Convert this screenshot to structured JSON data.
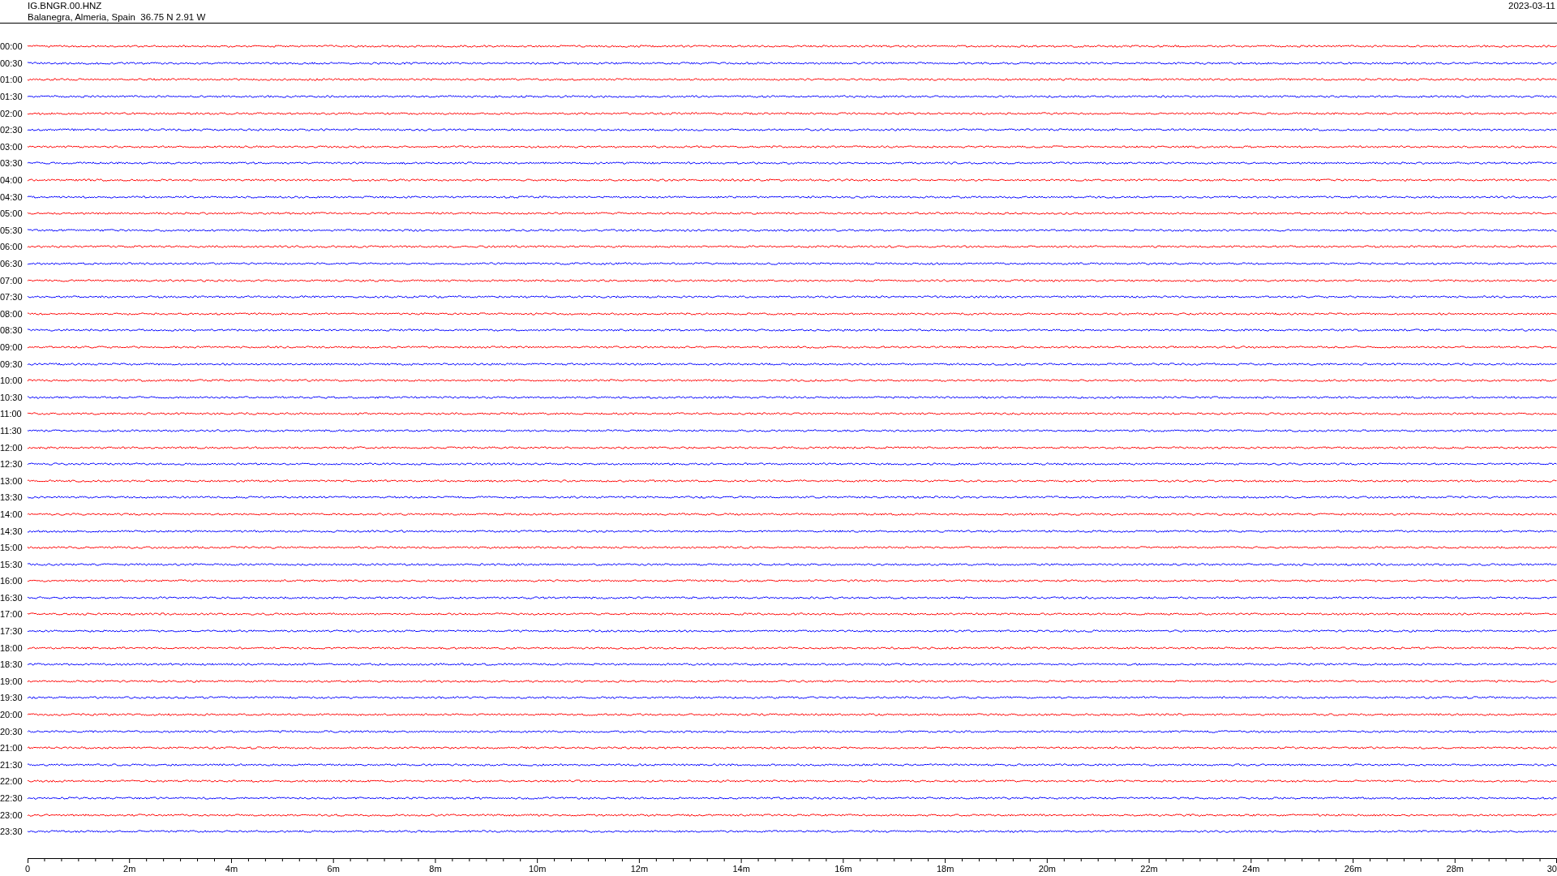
{
  "header": {
    "station": "IG.BNGR.00.HNZ",
    "location": "Balanegra, Almeria, Spain  36.75 N 2.91 W",
    "date": "2023-03-11"
  },
  "rows": [
    {
      "time": "00:00",
      "color": "#ff0000"
    },
    {
      "time": "00:30",
      "color": "#0000ff"
    },
    {
      "time": "01:00",
      "color": "#ff0000"
    },
    {
      "time": "01:30",
      "color": "#0000ff"
    },
    {
      "time": "02:00",
      "color": "#ff0000"
    },
    {
      "time": "02:30",
      "color": "#0000ff"
    },
    {
      "time": "03:00",
      "color": "#ff0000"
    },
    {
      "time": "03:30",
      "color": "#0000ff"
    },
    {
      "time": "04:00",
      "color": "#ff0000"
    },
    {
      "time": "04:30",
      "color": "#0000ff"
    },
    {
      "time": "05:00",
      "color": "#ff0000"
    },
    {
      "time": "05:30",
      "color": "#0000ff"
    },
    {
      "time": "06:00",
      "color": "#ff0000"
    },
    {
      "time": "06:30",
      "color": "#0000ff"
    },
    {
      "time": "07:00",
      "color": "#ff0000"
    },
    {
      "time": "07:30",
      "color": "#0000ff"
    },
    {
      "time": "08:00",
      "color": "#ff0000"
    },
    {
      "time": "08:30",
      "color": "#0000ff"
    },
    {
      "time": "09:00",
      "color": "#ff0000"
    },
    {
      "time": "09:30",
      "color": "#0000ff"
    },
    {
      "time": "10:00",
      "color": "#ff0000"
    },
    {
      "time": "10:30",
      "color": "#0000ff"
    },
    {
      "time": "11:00",
      "color": "#ff0000"
    },
    {
      "time": "11:30",
      "color": "#0000ff"
    },
    {
      "time": "12:00",
      "color": "#ff0000"
    },
    {
      "time": "12:30",
      "color": "#0000ff"
    },
    {
      "time": "13:00",
      "color": "#ff0000"
    },
    {
      "time": "13:30",
      "color": "#0000ff"
    },
    {
      "time": "14:00",
      "color": "#ff0000"
    },
    {
      "time": "14:30",
      "color": "#0000ff"
    },
    {
      "time": "15:00",
      "color": "#ff0000"
    },
    {
      "time": "15:30",
      "color": "#0000ff"
    },
    {
      "time": "16:00",
      "color": "#ff0000"
    },
    {
      "time": "16:30",
      "color": "#0000ff"
    },
    {
      "time": "17:00",
      "color": "#ff0000"
    },
    {
      "time": "17:30",
      "color": "#0000ff"
    },
    {
      "time": "18:00",
      "color": "#ff0000"
    },
    {
      "time": "18:30",
      "color": "#0000ff"
    },
    {
      "time": "19:00",
      "color": "#ff0000"
    },
    {
      "time": "19:30",
      "color": "#0000ff"
    },
    {
      "time": "20:00",
      "color": "#ff0000"
    },
    {
      "time": "20:30",
      "color": "#0000ff"
    },
    {
      "time": "21:00",
      "color": "#ff0000"
    },
    {
      "time": "21:30",
      "color": "#0000ff"
    },
    {
      "time": "22:00",
      "color": "#ff0000"
    },
    {
      "time": "22:30",
      "color": "#0000ff"
    },
    {
      "time": "23:00",
      "color": "#ff0000"
    },
    {
      "time": "23:30",
      "color": "#0000ff"
    }
  ],
  "x_axis": {
    "tick_labels": [
      "0",
      "2m",
      "4m",
      "6m",
      "8m",
      "10m",
      "12m",
      "14m",
      "16m",
      "18m",
      "20m",
      "22m",
      "24m",
      "26m",
      "28m",
      "30"
    ]
  }
}
